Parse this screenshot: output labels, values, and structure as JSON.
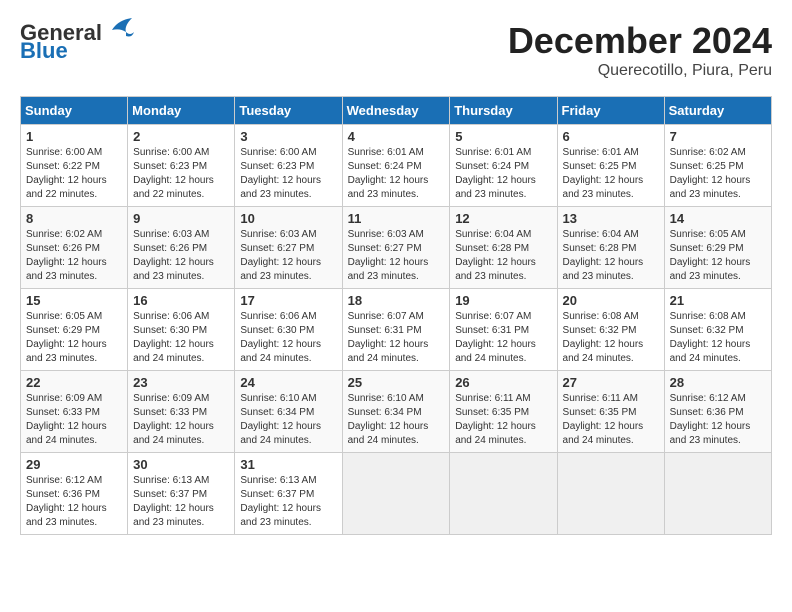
{
  "logo": {
    "general": "General",
    "blue": "Blue"
  },
  "title": "December 2024",
  "subtitle": "Querecotillo, Piura, Peru",
  "headers": [
    "Sunday",
    "Monday",
    "Tuesday",
    "Wednesday",
    "Thursday",
    "Friday",
    "Saturday"
  ],
  "weeks": [
    [
      {
        "day": "1",
        "info": "Sunrise: 6:00 AM\nSunset: 6:22 PM\nDaylight: 12 hours\nand 22 minutes."
      },
      {
        "day": "2",
        "info": "Sunrise: 6:00 AM\nSunset: 6:23 PM\nDaylight: 12 hours\nand 22 minutes."
      },
      {
        "day": "3",
        "info": "Sunrise: 6:00 AM\nSunset: 6:23 PM\nDaylight: 12 hours\nand 23 minutes."
      },
      {
        "day": "4",
        "info": "Sunrise: 6:01 AM\nSunset: 6:24 PM\nDaylight: 12 hours\nand 23 minutes."
      },
      {
        "day": "5",
        "info": "Sunrise: 6:01 AM\nSunset: 6:24 PM\nDaylight: 12 hours\nand 23 minutes."
      },
      {
        "day": "6",
        "info": "Sunrise: 6:01 AM\nSunset: 6:25 PM\nDaylight: 12 hours\nand 23 minutes."
      },
      {
        "day": "7",
        "info": "Sunrise: 6:02 AM\nSunset: 6:25 PM\nDaylight: 12 hours\nand 23 minutes."
      }
    ],
    [
      {
        "day": "8",
        "info": "Sunrise: 6:02 AM\nSunset: 6:26 PM\nDaylight: 12 hours\nand 23 minutes."
      },
      {
        "day": "9",
        "info": "Sunrise: 6:03 AM\nSunset: 6:26 PM\nDaylight: 12 hours\nand 23 minutes."
      },
      {
        "day": "10",
        "info": "Sunrise: 6:03 AM\nSunset: 6:27 PM\nDaylight: 12 hours\nand 23 minutes."
      },
      {
        "day": "11",
        "info": "Sunrise: 6:03 AM\nSunset: 6:27 PM\nDaylight: 12 hours\nand 23 minutes."
      },
      {
        "day": "12",
        "info": "Sunrise: 6:04 AM\nSunset: 6:28 PM\nDaylight: 12 hours\nand 23 minutes."
      },
      {
        "day": "13",
        "info": "Sunrise: 6:04 AM\nSunset: 6:28 PM\nDaylight: 12 hours\nand 23 minutes."
      },
      {
        "day": "14",
        "info": "Sunrise: 6:05 AM\nSunset: 6:29 PM\nDaylight: 12 hours\nand 23 minutes."
      }
    ],
    [
      {
        "day": "15",
        "info": "Sunrise: 6:05 AM\nSunset: 6:29 PM\nDaylight: 12 hours\nand 23 minutes."
      },
      {
        "day": "16",
        "info": "Sunrise: 6:06 AM\nSunset: 6:30 PM\nDaylight: 12 hours\nand 24 minutes."
      },
      {
        "day": "17",
        "info": "Sunrise: 6:06 AM\nSunset: 6:30 PM\nDaylight: 12 hours\nand 24 minutes."
      },
      {
        "day": "18",
        "info": "Sunrise: 6:07 AM\nSunset: 6:31 PM\nDaylight: 12 hours\nand 24 minutes."
      },
      {
        "day": "19",
        "info": "Sunrise: 6:07 AM\nSunset: 6:31 PM\nDaylight: 12 hours\nand 24 minutes."
      },
      {
        "day": "20",
        "info": "Sunrise: 6:08 AM\nSunset: 6:32 PM\nDaylight: 12 hours\nand 24 minutes."
      },
      {
        "day": "21",
        "info": "Sunrise: 6:08 AM\nSunset: 6:32 PM\nDaylight: 12 hours\nand 24 minutes."
      }
    ],
    [
      {
        "day": "22",
        "info": "Sunrise: 6:09 AM\nSunset: 6:33 PM\nDaylight: 12 hours\nand 24 minutes."
      },
      {
        "day": "23",
        "info": "Sunrise: 6:09 AM\nSunset: 6:33 PM\nDaylight: 12 hours\nand 24 minutes."
      },
      {
        "day": "24",
        "info": "Sunrise: 6:10 AM\nSunset: 6:34 PM\nDaylight: 12 hours\nand 24 minutes."
      },
      {
        "day": "25",
        "info": "Sunrise: 6:10 AM\nSunset: 6:34 PM\nDaylight: 12 hours\nand 24 minutes."
      },
      {
        "day": "26",
        "info": "Sunrise: 6:11 AM\nSunset: 6:35 PM\nDaylight: 12 hours\nand 24 minutes."
      },
      {
        "day": "27",
        "info": "Sunrise: 6:11 AM\nSunset: 6:35 PM\nDaylight: 12 hours\nand 24 minutes."
      },
      {
        "day": "28",
        "info": "Sunrise: 6:12 AM\nSunset: 6:36 PM\nDaylight: 12 hours\nand 23 minutes."
      }
    ],
    [
      {
        "day": "29",
        "info": "Sunrise: 6:12 AM\nSunset: 6:36 PM\nDaylight: 12 hours\nand 23 minutes."
      },
      {
        "day": "30",
        "info": "Sunrise: 6:13 AM\nSunset: 6:37 PM\nDaylight: 12 hours\nand 23 minutes."
      },
      {
        "day": "31",
        "info": "Sunrise: 6:13 AM\nSunset: 6:37 PM\nDaylight: 12 hours\nand 23 minutes."
      },
      null,
      null,
      null,
      null
    ]
  ]
}
